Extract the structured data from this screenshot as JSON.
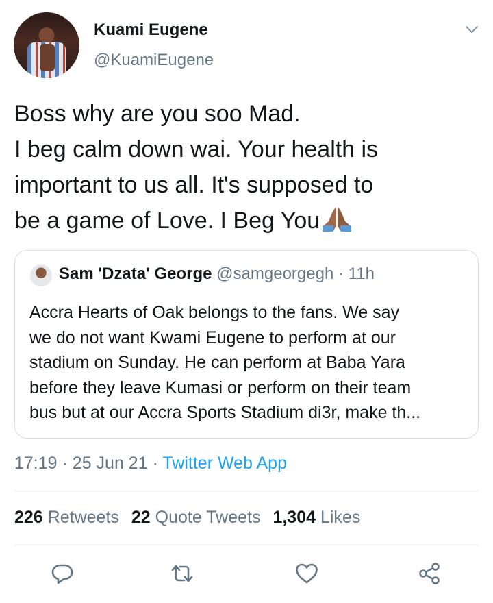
{
  "author": {
    "name": "Kuami Eugene",
    "handle": "@KuamiEugene"
  },
  "tweet": {
    "lines": [
      "Boss why are you soo Mad.",
      "I beg calm down wai. Your health is",
      "important to us all. It's supposed to",
      "be a game of Love.  I Beg You"
    ],
    "emoji": "folded-hands-emoji"
  },
  "quoted": {
    "name": "Sam 'Dzata' George",
    "handle": "@samgeorgegh",
    "separator": "·",
    "age": "11h",
    "lines": [
      "Accra Hearts of Oak belongs to the fans. We say",
      "we do not want Kwami Eugene to perform at our",
      "stadium on Sunday. He can perform at Baba Yara",
      "before they leave Kumasi or perform on their team",
      "bus but at our Accra Sports Stadium di3r, make th..."
    ]
  },
  "meta": {
    "time": "17:19",
    "separator": "·",
    "date": "25 Jun 21",
    "source": "Twitter Web App"
  },
  "stats": {
    "retweets_count": "226",
    "retweets_label": "Retweets",
    "quotes_count": "22",
    "quotes_label": "Quote Tweets",
    "likes_count": "1,304",
    "likes_label": "Likes"
  },
  "colors": {
    "text": "#14171a",
    "secondary": "#657786",
    "link": "#1da1f2",
    "border": "#d9dee2"
  },
  "icons": [
    "chevron-down-icon",
    "reply-icon",
    "retweet-icon",
    "like-icon",
    "share-icon"
  ]
}
